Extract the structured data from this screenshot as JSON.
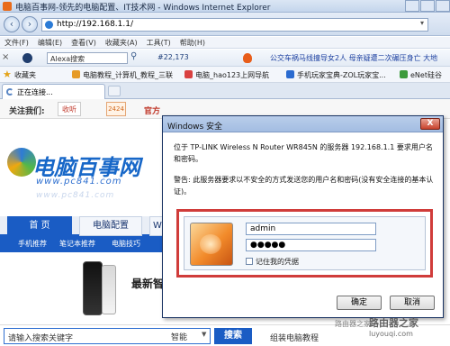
{
  "browser": {
    "title": "电脑百事网-领先的电脑配置、IT技术网 - Windows Internet Explorer",
    "url": "http://192.168.1.1/",
    "menu": [
      "文件(F)",
      "编辑(E)",
      "查看(V)",
      "收藏夹(A)",
      "工具(T)",
      "帮助(H)"
    ],
    "toolbar": {
      "close_glyph": "×",
      "alexa_placeholder": "Alexa搜索",
      "rank": "#22,173",
      "news": "公交车祸马线撞导女2人 母亲疑遭二次碾压身亡 大地"
    },
    "favorites": {
      "label": "收藏夹",
      "items": [
        "电脑教程_计算机_教程_三联",
        "电脑_hao123上网导航",
        "手机玩家宝典-ZOL玩家宝...",
        "eNet硅谷"
      ]
    },
    "tab": {
      "label": "正在连接..."
    }
  },
  "site": {
    "follow_label": "关注我们:",
    "weibo": "收听",
    "box2424": "2424",
    "official": "官方",
    "logo_text": "电脑百事网",
    "logo_url": "www.pc841.com",
    "logo_reflection": "www.pc841.com",
    "nav": {
      "home": "首 页",
      "config": "电脑配置",
      "more": "W"
    },
    "subnav": [
      "手机推荐",
      "笔记本推荐",
      "电脑技巧"
    ],
    "latest": "最新智",
    "search": {
      "placeholder": "请输入搜索关键字",
      "mode": "智能",
      "button": "搜索",
      "assemble": "组装电脑教程"
    }
  },
  "dialog": {
    "title": "Windows 安全",
    "close": "X",
    "message": "位于 TP-LINK Wireless N Router WR845N 的服务器 192.168.1.1 要求用户名和密码。",
    "warning": "警告: 此服务器要求以不安全的方式发送您的用户名和密码(没有安全连接的基本认证)。",
    "username": "admin",
    "password": "●●●●●",
    "remember": "记住我的凭据",
    "ok": "确定",
    "cancel": "取消"
  },
  "watermark": {
    "line0": "路由器之家",
    "line1": "路由器之家",
    "line2": "luyouqi.com"
  }
}
